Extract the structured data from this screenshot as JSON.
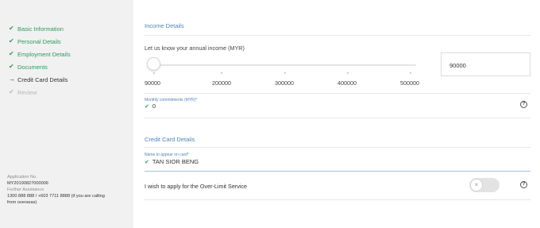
{
  "sidebar": {
    "steps": [
      {
        "label": "Basic Information",
        "state": "done",
        "icon": "check-icon"
      },
      {
        "label": "Personal Details",
        "state": "done",
        "icon": "check-icon"
      },
      {
        "label": "Employment Details",
        "state": "done",
        "icon": "check-icon"
      },
      {
        "label": "Documents",
        "state": "done",
        "icon": "check-icon"
      },
      {
        "label": "Credit Card Details",
        "state": "current",
        "icon": "arrow-right-icon"
      },
      {
        "label": "Review",
        "state": "disabled",
        "icon": "check-icon"
      }
    ],
    "application_no_label": "Application No.",
    "application_no": "MY20190827000006",
    "assistance_label": "Further Assistance",
    "assistance_text_1": "1300 888 888 / +603 7711 8888 (if you are calling",
    "assistance_text_2": "from overseas)"
  },
  "income": {
    "section_title": "Income Details",
    "question": "Let us know your annual income (MYR)",
    "ticks": [
      "90000",
      "200000",
      "300000",
      "400000",
      "500000"
    ],
    "value": "90000",
    "slider_value": 90000,
    "slider_min": 90000,
    "slider_max": 500000
  },
  "commitments": {
    "label": "Monthly commitments (MYR)*",
    "value": "0"
  },
  "credit_card": {
    "section_title": "Credit Card Details",
    "name_label": "Name to appear on card*",
    "name_value": "TAN SIOR BENG",
    "overlimit_label": "I wish to apply for the Over-Limit Service",
    "overlimit_on": false
  },
  "colors": {
    "accent_green": "#2e9b5b",
    "accent_blue": "#4f85b9",
    "sidebar_bg": "#f1f1f1"
  }
}
